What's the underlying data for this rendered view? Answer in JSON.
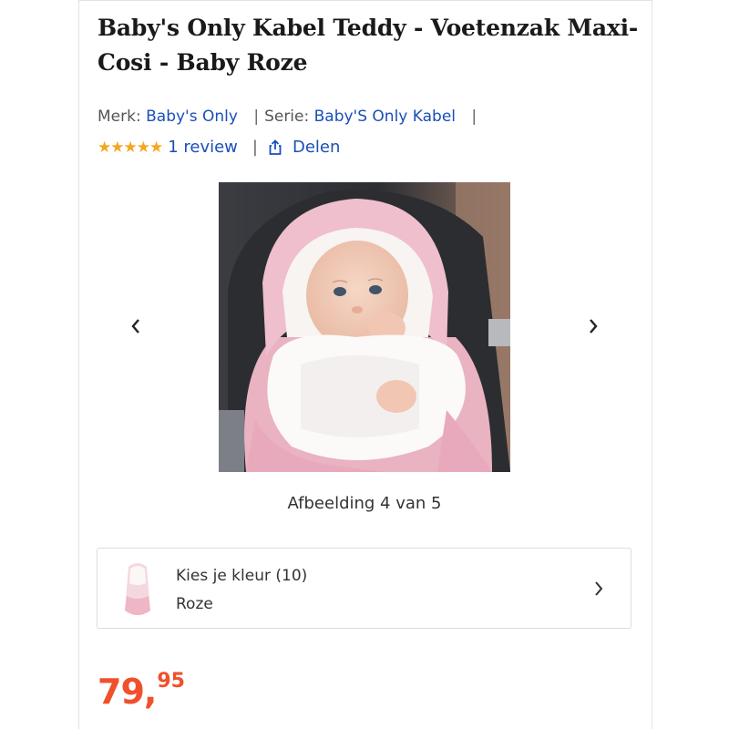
{
  "product": {
    "title": "Baby's Only Kabel Teddy - Voetenzak Maxi-Cosi - Baby Roze",
    "brand_label": "Merk:",
    "brand": "Baby's Only",
    "series_label": "Serie:",
    "series": "Baby'S Only Kabel",
    "rating_stars": "★★★★★",
    "rating_value": 5,
    "reviews": "1 review",
    "share": "Delen"
  },
  "gallery": {
    "counter": "Afbeelding 4 van 5",
    "current": 4,
    "total": 5
  },
  "color_selector": {
    "label": "Kies je kleur (10)",
    "selected": "Roze"
  },
  "price": {
    "main": "79,",
    "cents": "95"
  },
  "colors": {
    "link": "#1a4fb8",
    "price": "#f0502b",
    "stars": "#f5a623"
  },
  "icons": {
    "share": "share-icon",
    "prev": "chevron-left-icon",
    "next": "chevron-right-icon",
    "color_next": "chevron-right-icon"
  }
}
